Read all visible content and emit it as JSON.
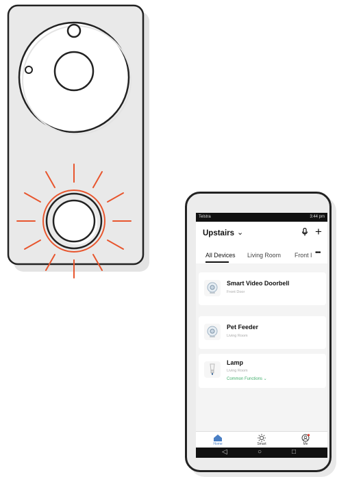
{
  "status_bar": {
    "carrier": "Telstra",
    "right": "3:44 pm"
  },
  "header": {
    "home_name": "Upstairs",
    "chevron": "⌄",
    "mic_icon": "mic-icon",
    "add_icon": "plus-icon"
  },
  "tabs": {
    "items": [
      "All Devices",
      "Living Room",
      "Front I"
    ],
    "active": "All Devices",
    "more": "•••"
  },
  "devices": [
    {
      "name": "Smart Video Doorbell",
      "room": "Front Door",
      "icon": "camera-icon"
    },
    {
      "name": "Pet Feeder",
      "room": "Living Room",
      "icon": "camera-icon"
    },
    {
      "name": "Lamp",
      "room": "Living Room",
      "functions": "Common Functions ⌄",
      "icon": "bulb-icon"
    }
  ],
  "bottom_nav": [
    {
      "label": "Home",
      "icon": "home-icon",
      "active": true
    },
    {
      "label": "Smart",
      "icon": "sun-icon",
      "active": false
    },
    {
      "label": "Me",
      "icon": "user-icon",
      "active": false
    }
  ],
  "system_keys": {
    "back": "◁",
    "home": "○",
    "recents": "□"
  },
  "colors": {
    "ring_accent": "#e8552d",
    "active_nav": "#4a7fc4",
    "function_link": "#3fae6a"
  }
}
